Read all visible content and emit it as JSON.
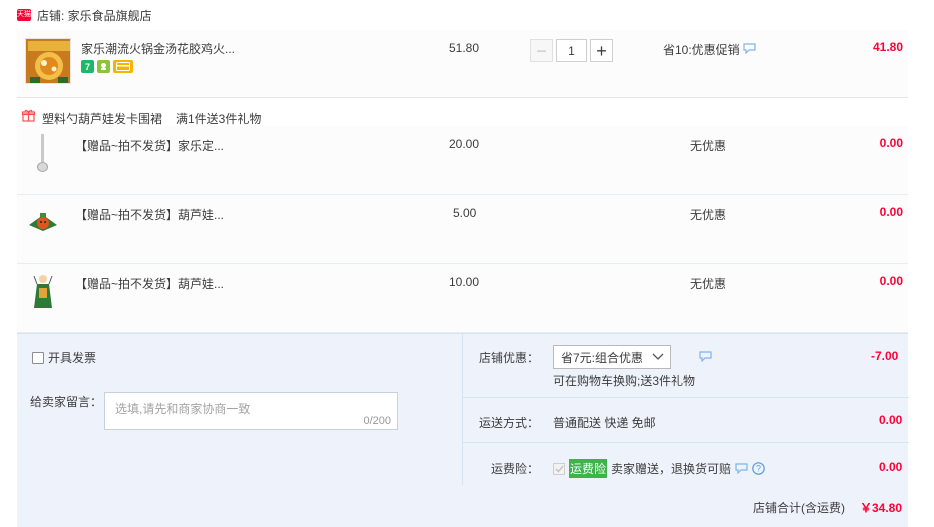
{
  "shop": {
    "badge": "天猫",
    "name": "店铺: 家乐食品旗舰店"
  },
  "main_item": {
    "title": "家乐潮流火锅金汤花胶鸡火...",
    "price": "51.80",
    "quantity": "1",
    "promo": "省10:优惠促销",
    "total": "41.80",
    "tag_icons": [
      "seven-day-return-icon",
      "service-badge-icon",
      "credit-card-icon"
    ],
    "tag_colors": [
      "#1fb86a",
      "#8cc43c",
      "#f5b400"
    ],
    "tag_texts": [
      "7",
      "",
      ""
    ]
  },
  "gift_header": {
    "name": "塑料勺葫芦娃发卡围裙",
    "rule": "满1件送3件礼物"
  },
  "gifts": [
    {
      "title": "【赠品~拍不发货】家乐定...",
      "price": "20.00",
      "promo": "无优惠",
      "total": "0.00"
    },
    {
      "title": "【赠品~拍不发货】葫芦娃...",
      "price": "5.00",
      "promo": "无优惠",
      "total": "0.00"
    },
    {
      "title": "【赠品~拍不发货】葫芦娃...",
      "price": "10.00",
      "promo": "无优惠",
      "total": "0.00"
    }
  ],
  "invoice": {
    "label": "开具发票"
  },
  "message": {
    "label": "给卖家留言：",
    "placeholder": "选填,请先和商家协商一致",
    "counter": "0/200"
  },
  "shop_discount": {
    "label": "店铺优惠：",
    "selected": "省7元:组合优惠",
    "note": "可在购物车换购;送3件礼物",
    "amount": "-7.00"
  },
  "shipping": {
    "label": "运送方式：",
    "method": "普通配送 快递 免邮",
    "amount": "0.00"
  },
  "insurance": {
    "label": "运费险：",
    "badge": "运费险",
    "text": "卖家赠送，退换货可赔",
    "amount": "0.00"
  },
  "summary": {
    "label": "店铺合计(含运费)",
    "total": "￥34.80"
  },
  "colors": {
    "accent_red": "#ff0036",
    "panel_bg": "#eef3fb",
    "link_blue": "#3d8ede"
  }
}
